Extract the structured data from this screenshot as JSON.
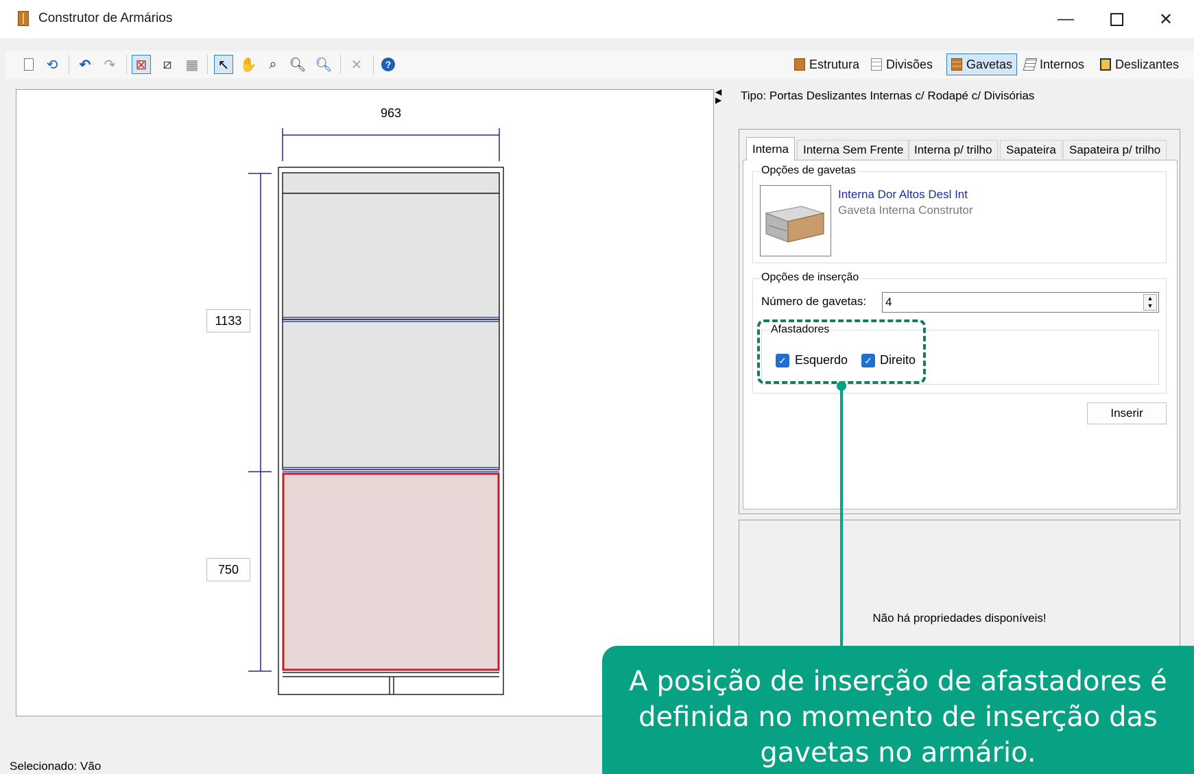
{
  "window": {
    "title": "Construtor de Armários",
    "controls": [
      "minimize",
      "maximize",
      "close"
    ]
  },
  "toolbar": {
    "left_icons": [
      "new-icon",
      "reset-icon",
      "undo-icon",
      "redo-icon",
      "snap-icon",
      "dimension-icon",
      "grid-icon",
      "select-icon",
      "hand-icon",
      "zoom-fit-icon",
      "zoom-out-icon",
      "zoom-in-icon",
      "delete-icon",
      "help-icon"
    ],
    "mode_tabs": [
      {
        "label": "Estrutura",
        "icon": "structure-icon"
      },
      {
        "label": "Divisões",
        "icon": "divisions-icon"
      },
      {
        "label": "Gavetas",
        "icon": "drawers-icon",
        "selected": true
      },
      {
        "label": "Internos",
        "icon": "internals-icon"
      },
      {
        "label": "Deslizantes",
        "icon": "sliding-icon"
      }
    ]
  },
  "drawing": {
    "width_dim": "963",
    "height_dims": [
      "1133",
      "750"
    ]
  },
  "panel": {
    "tipo": "Tipo: Portas Deslizantes Internas c/ Rodapé c/ Divisórias",
    "tabs": [
      "Interna",
      "Interna Sem Frente",
      "Interna p/ trilho",
      "Sapateira",
      "Sapateira p/ trilho"
    ],
    "drawer_options_title": "Opções de gavetas",
    "drawer_name": "Interna Dor Altos Desl Int",
    "drawer_desc": "Gaveta Interna Construtor",
    "insert_options_title": "Opções de inserção",
    "num_label": "Número de gavetas:",
    "num_value": "4",
    "afastadores_title": "Afastadores",
    "left_label": "Esquerdo",
    "right_label": "Direito",
    "insert_button": "Inserir",
    "no_props": "Não há propriedades disponíveis!"
  },
  "status": "Selecionado: Vão",
  "callout": {
    "line1": "A posição de inserção de afastadores é",
    "line2": "definida no momento de inserção das",
    "line3": "gavetas no armário."
  },
  "colors": {
    "accent": "#06a283",
    "selection_fill": "#e8d6d6",
    "selection_border": "#c0202a",
    "dim_line": "#1f2b8f"
  }
}
